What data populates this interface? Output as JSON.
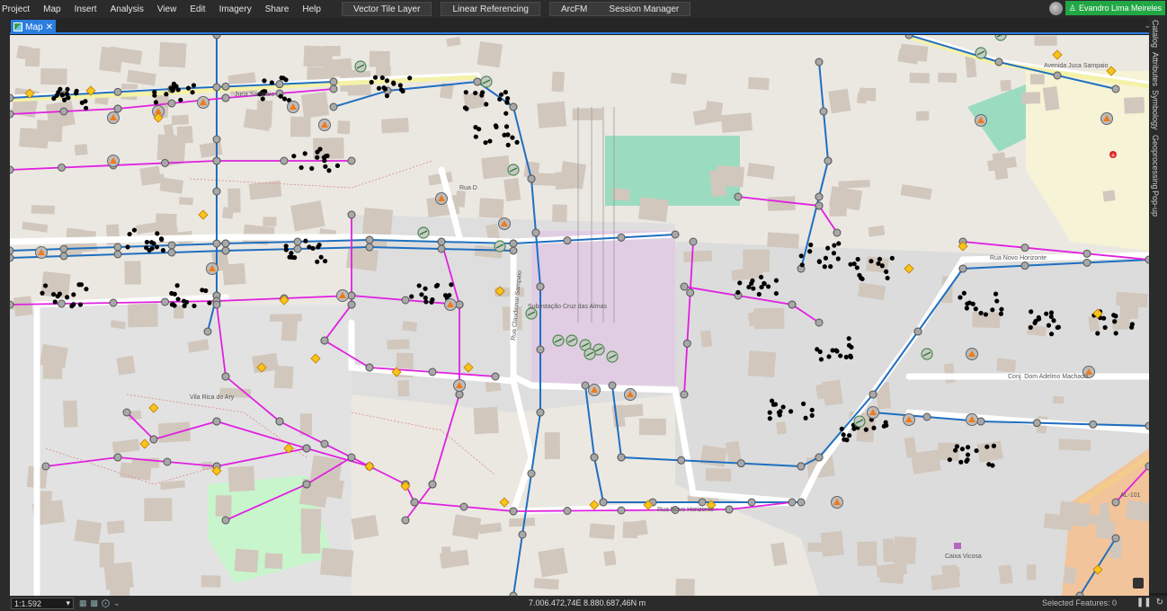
{
  "menubar": {
    "items": [
      "Project",
      "Map",
      "Insert",
      "Analysis",
      "View",
      "Edit",
      "Imagery",
      "Share",
      "Help"
    ],
    "tabs": [
      "Vector Tile Layer",
      "Linear Referencing"
    ],
    "group": [
      "ArcFM",
      "Session Manager"
    ]
  },
  "user": {
    "name": "Evandro Lima Meireles"
  },
  "map_tab": {
    "label": "Map",
    "close": "✕"
  },
  "right_dock": [
    "Catalog",
    "Attributes",
    "Symbology",
    "Geoprocessing",
    "Pop-up"
  ],
  "map_labels": {
    "substation": "Subestação Cruz das Almas",
    "street_juca": "Juca Sampaio",
    "street_juca2": "Avenida Juca Sampaio",
    "street_rua_d": "Rua D",
    "street_novo_horizonte": "Rua Novo Horizonte",
    "street_novo_horizonte2": "Rua Novo Horizonte",
    "street_claudionor": "Rua Claudionor Sampaio",
    "vila": "Vila Rica do Ary",
    "conj": "Conj. Dom Adelmo Machado",
    "al": "AL-101",
    "caixa": "Caixa Vicosa"
  },
  "status": {
    "scale": "1:1.592",
    "coordinates": "7.006.472,74E 8.880.687,46N m",
    "selected": "Selected Features: 0"
  },
  "colors": {
    "magenta_line": "#e020e0",
    "blue_line": "#1f6fc0",
    "accent": "#2b7de0",
    "user_bg": "#22a745"
  }
}
